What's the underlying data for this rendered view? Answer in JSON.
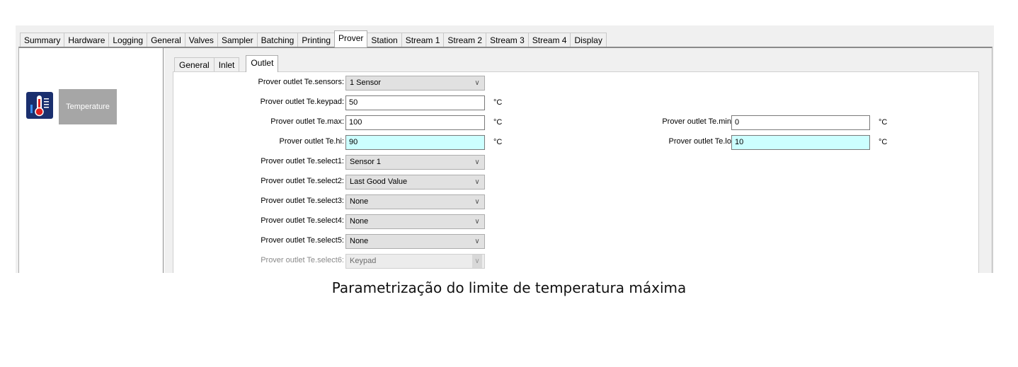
{
  "main_tabs": [
    "Summary",
    "Hardware",
    "Logging",
    "General",
    "Valves",
    "Sampler",
    "Batching",
    "Printing",
    "Prover",
    "Station",
    "Stream 1",
    "Stream 2",
    "Stream 3",
    "Stream 4",
    "Display"
  ],
  "active_main_tab": "Prover",
  "left_pane": {
    "tile_label": "Temperature",
    "icon": "thermometer-icon"
  },
  "sub_tabs": [
    "General",
    "Inlet",
    "Outlet"
  ],
  "active_sub_tab": "Outlet",
  "form": {
    "sensors": {
      "label": "Prover outlet Te.sensors:",
      "value": "1 Sensor"
    },
    "keypad": {
      "label": "Prover outlet Te.keypad:",
      "value": "50",
      "unit": "°C"
    },
    "max": {
      "label": "Prover outlet Te.max:",
      "value": "100",
      "unit": "°C"
    },
    "hi": {
      "label": "Prover outlet Te.hi:",
      "value": "90",
      "unit": "°C"
    },
    "min": {
      "label": "Prover outlet Te.min:",
      "value": "0",
      "unit": "°C"
    },
    "lo": {
      "label": "Prover outlet Te.lo:",
      "value": "10",
      "unit": "°C"
    },
    "select1": {
      "label": "Prover outlet Te.select1:",
      "value": "Sensor 1"
    },
    "select2": {
      "label": "Prover outlet Te.select2:",
      "value": "Last Good Value"
    },
    "select3": {
      "label": "Prover outlet Te.select3:",
      "value": "None"
    },
    "select4": {
      "label": "Prover outlet Te.select4:",
      "value": "None"
    },
    "select5": {
      "label": "Prover outlet Te.select5:",
      "value": "None"
    },
    "select6": {
      "label": "Prover outlet Te.select6:",
      "value": "Keypad"
    }
  },
  "colors": {
    "highlight_field": "#ccffff",
    "icon_bg": "#1a2f6e",
    "tile_bg": "#a6a6a6"
  },
  "caption": "Parametrização do limite de temperatura máxima"
}
